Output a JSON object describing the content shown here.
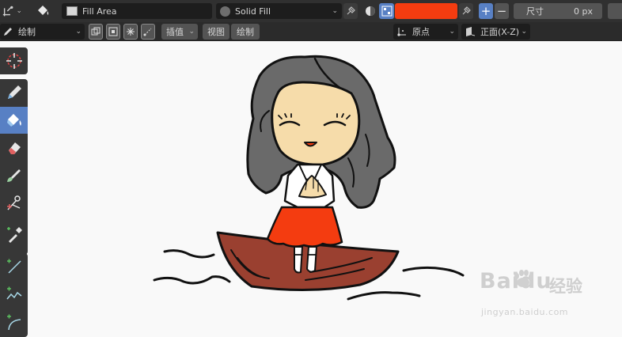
{
  "header": {
    "fill_name": "Fill Area",
    "fill_mode": "Solid Fill",
    "swatch_color": "#f43c10",
    "size_label": "尺寸",
    "size_value": "0 px"
  },
  "tool_settings": {
    "mode": "绘制",
    "interp": "插值",
    "view": "视图",
    "draw": "绘制",
    "origin": "原点",
    "plane": "正面(X-Z)"
  },
  "toolbar": {
    "tools": [
      "cursor-tool",
      "draw-tool",
      "fill-tool",
      "erase-tool",
      "tint-tool",
      "cutter-tool",
      "eyedropper-tool",
      "line-tool",
      "polyline-tool",
      "arc-tool"
    ],
    "active": "fill-tool"
  },
  "watermark": {
    "brand": "Baidu",
    "brand_cn": "经验",
    "url": "jingyan.baidu.com"
  },
  "colors": {
    "hair": "#6a6a6a",
    "skin": "#f6dcaa",
    "skirt": "#f43c10",
    "boat": "#9a4030",
    "active_tool": "#5880c4"
  }
}
